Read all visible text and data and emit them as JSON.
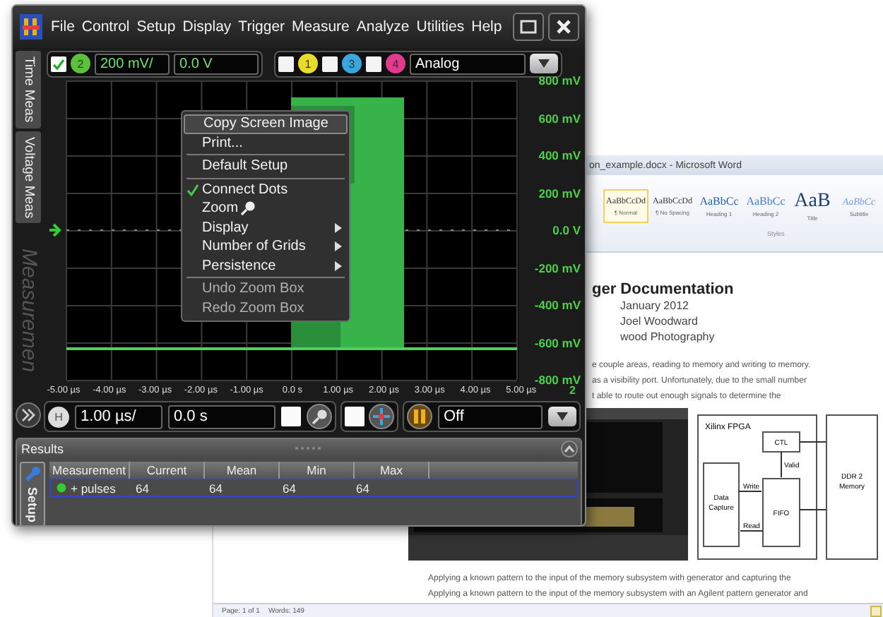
{
  "word_window": {
    "title": "on_example.docx - Microsoft Word",
    "styles": [
      {
        "sample": "AaBbCcDd",
        "name": "¶ Normal",
        "kind": "normal",
        "selected": true
      },
      {
        "sample": "AaBbCcDd",
        "name": "¶ No Spacing",
        "kind": "normal",
        "selected": false
      },
      {
        "sample": "AaBbCc",
        "name": "Heading 1",
        "kind": "heading",
        "selected": false
      },
      {
        "sample": "AaBbCc",
        "name": "Heading 2",
        "kind": "heading2",
        "selected": false
      },
      {
        "sample": "AaB",
        "name": "Title",
        "kind": "title",
        "selected": false
      },
      {
        "sample": "AaBbCc",
        "name": "Subtitle",
        "kind": "subtle",
        "selected": false
      }
    ],
    "styles_group": "Styles",
    "heading": "ger Documentation",
    "meta_lines": [
      "January 2012",
      "Joel Woodward",
      "wood Photography"
    ],
    "paragraph_lines": [
      "e couple areas, reading to memory and writing to memory.",
      "as a visibility port.  Unfortunately, due to the small number",
      "t able to route out enough signals to determine the"
    ],
    "diagram": {
      "fpga": "Xilinx FPGA",
      "ctl": "CTL",
      "valid": "Valid",
      "write": "Write",
      "capture": [
        "Data",
        "Capture"
      ],
      "fifo": "FIFO",
      "read": "Read",
      "memory": [
        "DDR 2",
        "Memory"
      ]
    },
    "bottom_lines": [
      "Applying  a known pattern to the input  of the memory subsystem  with generator and capturing the",
      "Applying  a known pattern to the input  of the memory subsystem with an Agilent pattern generator and"
    ],
    "status_bar": [
      "Page: 1 of 1",
      "Words: 149"
    ]
  },
  "scope_window": {
    "menu": [
      "File",
      "Control",
      "Setup",
      "Display",
      "Trigger",
      "Measure",
      "Analyze",
      "Utilities",
      "Help"
    ],
    "side_tabs": [
      {
        "label": "Time Meas",
        "dimmed": false
      },
      {
        "label": "Voltage Meas",
        "dimmed": false
      },
      {
        "label": "Measuremen",
        "dimmed": true
      }
    ],
    "active_channel": {
      "label": "2",
      "checked": true,
      "scale": "200 mV/",
      "offset": "0.0 V"
    },
    "channels": [
      {
        "label": "1",
        "color": "#e6dc2a",
        "checked": false
      },
      {
        "label": "3",
        "color": "#3aa6e0",
        "checked": false
      },
      {
        "label": "4",
        "color": "#e23a8e",
        "checked": false
      }
    ],
    "mode": "Analog",
    "y_labels": [
      "800 mV",
      "600 mV",
      "400 mV",
      "200 mV",
      "0.0 V",
      "-200 mV",
      "-400 mV",
      "-600 mV",
      "-800 mV"
    ],
    "x_labels": [
      "-5.00 µs",
      "-4.00 µs",
      "-3.00 µs",
      "-2.00 µs",
      "-1.00 µs",
      "0.0 s",
      "1.00 µs",
      "2.00 µs",
      "3.00 µs",
      "4.00 µs",
      "5.00 µs"
    ],
    "x_marker": "2",
    "context_menu": [
      {
        "label": "Copy Screen Image",
        "kind": "item",
        "highlighted": true,
        "checked": false,
        "disabled": false
      },
      {
        "label": "Print...",
        "kind": "item",
        "highlighted": false,
        "checked": false,
        "disabled": false
      },
      {
        "kind": "divider"
      },
      {
        "label": "Default Setup",
        "kind": "item",
        "highlighted": false,
        "checked": false,
        "disabled": false
      },
      {
        "kind": "divider"
      },
      {
        "label": "Connect Dots",
        "kind": "item",
        "highlighted": false,
        "checked": true,
        "disabled": false
      },
      {
        "label": "Zoom",
        "kind": "zoom",
        "highlighted": false,
        "checked": false,
        "disabled": false
      },
      {
        "label": "Display",
        "kind": "submenu",
        "highlighted": false,
        "checked": false,
        "disabled": false
      },
      {
        "label": "Number of Grids",
        "kind": "submenu",
        "highlighted": false,
        "checked": false,
        "disabled": false
      },
      {
        "label": "Persistence",
        "kind": "submenu",
        "highlighted": false,
        "checked": false,
        "disabled": false
      },
      {
        "kind": "divider"
      },
      {
        "label": "Undo Zoom Box",
        "kind": "item",
        "highlighted": false,
        "checked": false,
        "disabled": true
      },
      {
        "label": "Redo Zoom Box",
        "kind": "item",
        "highlighted": false,
        "checked": false,
        "disabled": true
      }
    ],
    "timebase": {
      "button": "H",
      "scale": "1.00 µs/",
      "position": "0.0 s"
    },
    "zoom_checked": false,
    "marker_checked": false,
    "trigger": "Off",
    "results": {
      "title": "Results",
      "setup_tab": "Setup",
      "columns": [
        "Measurement",
        "Current",
        "Mean",
        "Min",
        "Max"
      ],
      "rows": [
        {
          "cells": [
            "+ pulses",
            "64",
            "64",
            "64",
            "64"
          ],
          "selected": true
        }
      ]
    }
  }
}
